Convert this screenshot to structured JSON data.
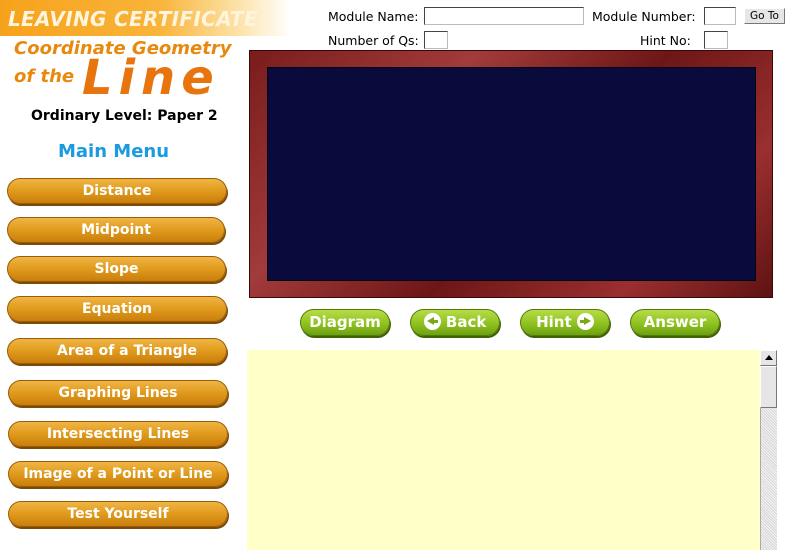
{
  "header": {
    "banner": "LEAVING CERTIFICATE",
    "subtitle_line1": "Coordinate Geometry",
    "subtitle_line2": "of the",
    "subtitle_big": "Line",
    "level": "Ordinary Level: Paper 2"
  },
  "menu": {
    "title": "Main Menu",
    "items": [
      {
        "label": "Distance"
      },
      {
        "label": "Midpoint"
      },
      {
        "label": "Slope"
      },
      {
        "label": "Equation"
      },
      {
        "label": "Area of a Triangle"
      },
      {
        "label": "Graphing Lines"
      },
      {
        "label": "Intersecting Lines"
      },
      {
        "label": "Image of a Point or Line"
      },
      {
        "label": "Test Yourself"
      }
    ]
  },
  "form": {
    "module_name_label": "Module Name:",
    "module_name_value": "",
    "module_number_label": "Module Number:",
    "module_number_value": "",
    "goto_label": "Go To",
    "num_qs_label": "Number of Qs:",
    "num_qs_value": "",
    "hint_no_label": "Hint No:",
    "hint_no_value": ""
  },
  "controls": {
    "diagram_label": "Diagram",
    "back_label": "Back",
    "hint_label": "Hint",
    "answer_label": "Answer"
  },
  "colors": {
    "menu_button": "#e09a1c",
    "control_button": "#8ec21f",
    "board": "#0a0a3c",
    "board_frame": "#7a1c1c",
    "answer_area": "#ffffc8",
    "menu_title": "#1a9ae0"
  },
  "icons": {
    "back": "arrow-left-icon",
    "hint": "arrow-right-icon"
  }
}
